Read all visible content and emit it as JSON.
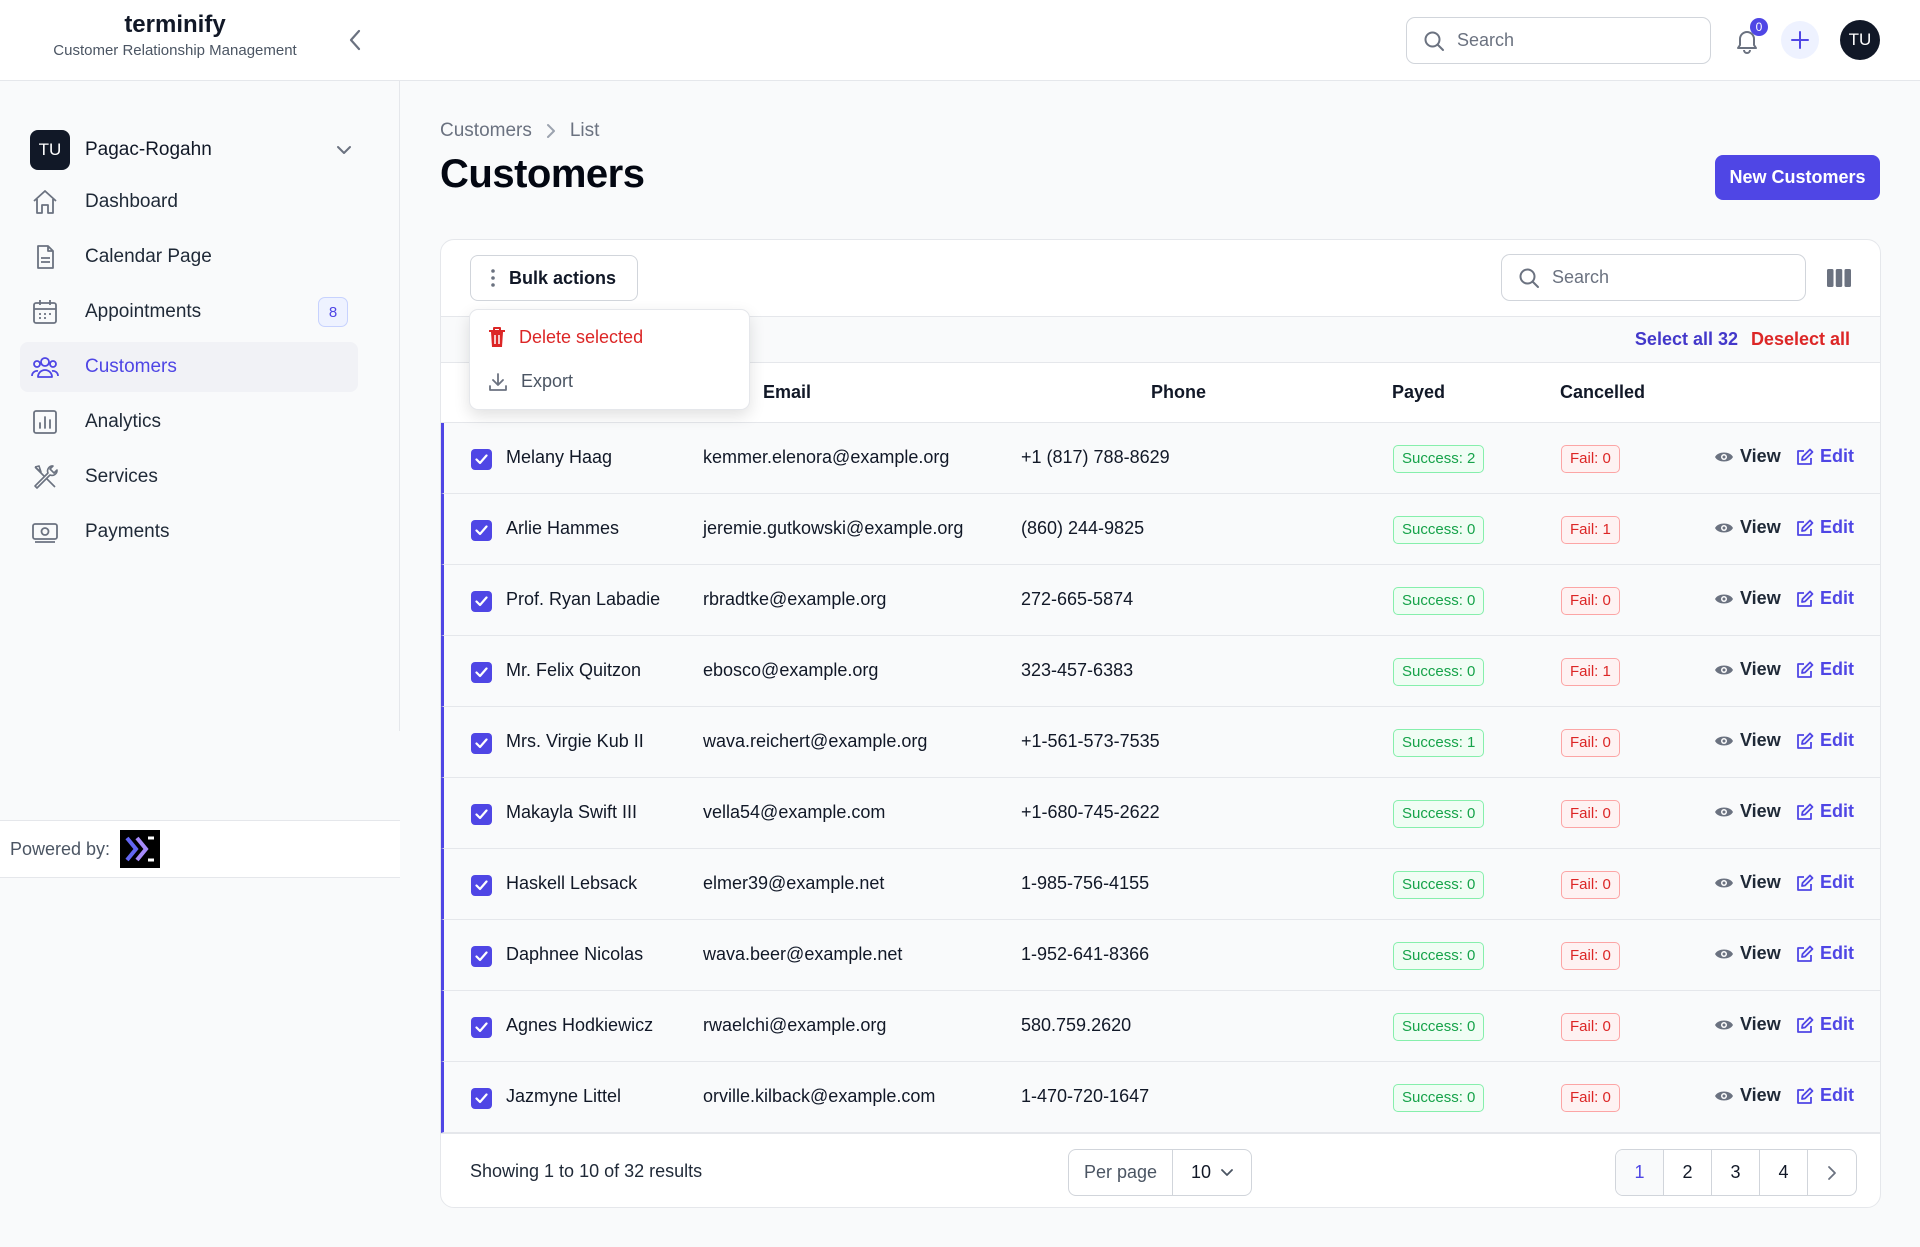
{
  "app": {
    "brand_name": "terminify",
    "brand_tagline": "Customer Relationship Management"
  },
  "topbar": {
    "search_placeholder": "Search",
    "notification_count": "0",
    "avatar_initials": "TU"
  },
  "sidebar": {
    "tenant": {
      "initials": "TU",
      "name": "Pagac-Rogahn"
    },
    "items": [
      {
        "label": "Dashboard",
        "icon": "home-icon",
        "active": false,
        "badge": ""
      },
      {
        "label": "Calendar Page",
        "icon": "document-icon",
        "active": false,
        "badge": ""
      },
      {
        "label": "Appointments",
        "icon": "calendar-icon",
        "active": false,
        "badge": "8"
      },
      {
        "label": "Customers",
        "icon": "users-icon",
        "active": true,
        "badge": ""
      },
      {
        "label": "Analytics",
        "icon": "chart-icon",
        "active": false,
        "badge": ""
      },
      {
        "label": "Services",
        "icon": "tools-icon",
        "active": false,
        "badge": ""
      },
      {
        "label": "Payments",
        "icon": "cash-icon",
        "active": false,
        "badge": ""
      }
    ],
    "powered_by": "Powered by:"
  },
  "breadcrumb": {
    "parent": "Customers",
    "current": "List"
  },
  "page": {
    "title": "Customers",
    "new_button": "New Customers"
  },
  "table": {
    "bulk_actions_label": "Bulk actions",
    "search_placeholder": "Search",
    "select_all_label": "Select all 32",
    "deselect_all_label": "Deselect all",
    "columns": {
      "email": "Email",
      "phone": "Phone",
      "payed": "Payed",
      "cancelled": "Cancelled"
    },
    "view_label": "View",
    "edit_label": "Edit",
    "rows": [
      {
        "name": "Melany Haag",
        "email": "kemmer.elenora@example.org",
        "phone": "+1 (817) 788-8629",
        "payed": "Success: 2",
        "cancelled": "Fail: 0"
      },
      {
        "name": "Arlie Hammes",
        "email": "jeremie.gutkowski@example.org",
        "phone": "(860) 244-9825",
        "payed": "Success: 0",
        "cancelled": "Fail: 1"
      },
      {
        "name": "Prof. Ryan Labadie",
        "email": "rbradtke@example.org",
        "phone": "272-665-5874",
        "payed": "Success: 0",
        "cancelled": "Fail: 0"
      },
      {
        "name": "Mr. Felix Quitzon",
        "email": "ebosco@example.org",
        "phone": "323-457-6383",
        "payed": "Success: 0",
        "cancelled": "Fail: 1"
      },
      {
        "name": "Mrs. Virgie Kub II",
        "email": "wava.reichert@example.org",
        "phone": "+1-561-573-7535",
        "payed": "Success: 1",
        "cancelled": "Fail: 0"
      },
      {
        "name": "Makayla Swift III",
        "email": "vella54@example.com",
        "phone": "+1-680-745-2622",
        "payed": "Success: 0",
        "cancelled": "Fail: 0"
      },
      {
        "name": "Haskell Lebsack",
        "email": "elmer39@example.net",
        "phone": "1-985-756-4155",
        "payed": "Success: 0",
        "cancelled": "Fail: 0"
      },
      {
        "name": "Daphnee Nicolas",
        "email": "wava.beer@example.net",
        "phone": "1-952-641-8366",
        "payed": "Success: 0",
        "cancelled": "Fail: 0"
      },
      {
        "name": "Agnes Hodkiewicz",
        "email": "rwaelchi@example.org",
        "phone": "580.759.2620",
        "payed": "Success: 0",
        "cancelled": "Fail: 0"
      },
      {
        "name": "Jazmyne Littel",
        "email": "orville.kilback@example.com",
        "phone": "1-470-720-1647",
        "payed": "Success: 0",
        "cancelled": "Fail: 0"
      }
    ],
    "footer": {
      "showing": "Showing 1 to 10 of 32 results",
      "per_page_label": "Per page",
      "per_page_value": "10",
      "pages": [
        "1",
        "2",
        "3",
        "4"
      ],
      "active_page": "1"
    }
  },
  "dropdown": {
    "delete_label": "Delete selected",
    "export_label": "Export"
  },
  "colors": {
    "accent": "#4f46e5",
    "danger": "#dc2626",
    "success": "#16a34a"
  }
}
